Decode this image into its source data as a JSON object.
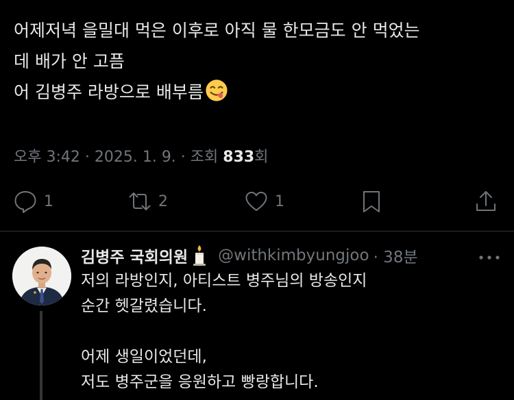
{
  "tweet": {
    "lines": [
      "어제저녁 을밀대 먹은 이후로 아직 물 한모금도 안 먹었는",
      "데 배가 안 고픔",
      "어 김병주 라방으로 배부름"
    ],
    "emoji": "face-savoring-food-emoji"
  },
  "meta": {
    "prefix": "오후 3:42 · 2025. 1. 9. · 조회 ",
    "views": "833",
    "suffix": "회"
  },
  "actions": {
    "reply_count": "1",
    "retweet_count": "2",
    "like_count": "1"
  },
  "reply": {
    "name": "김병주 국회의원",
    "handle": "@withkimbyungjoo",
    "time": "· 38분",
    "lines": [
      "저의 라방인지, 아티스트 병주님의 방송인지",
      "순간 헷갈렸습니다.",
      "",
      "어제 생일이었던데,",
      "저도 병주군을 응원하고 빵랑합니다."
    ]
  },
  "colors": {
    "background": "#000000",
    "text": "#e7e9ea",
    "muted": "#71767b",
    "divider": "#2f3336"
  }
}
